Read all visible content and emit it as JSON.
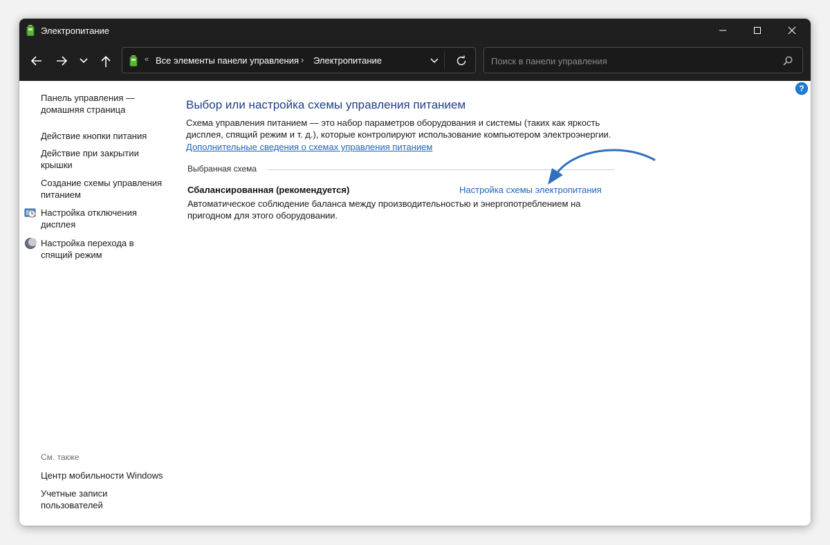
{
  "window": {
    "title": "Электропитание"
  },
  "address_bar": {
    "overflow_glyph": "«",
    "breadcrumbs": [
      "Все элементы панели управления",
      "Электропитание"
    ],
    "separator": "›"
  },
  "search": {
    "placeholder": "Поиск в панели управления",
    "value": ""
  },
  "help": {
    "label": "?"
  },
  "sidebar": {
    "items": [
      {
        "label": "Панель управления — домашняя страница"
      },
      {
        "label": "Действие кнопки питания"
      },
      {
        "label": "Действие при закрытии крышки"
      },
      {
        "label": "Создание схемы управления питанием"
      },
      {
        "label": "Настройка отключения дисплея",
        "icon": "display-clock-icon"
      },
      {
        "label": "Настройка перехода в спящий режим",
        "icon": "moon-icon"
      }
    ],
    "see_also_header": "См. также",
    "see_also": [
      {
        "label": "Центр мобильности Windows"
      },
      {
        "label": "Учетные записи пользователей"
      }
    ]
  },
  "main": {
    "title": "Выбор или настройка схемы управления питанием",
    "description": "Схема управления питанием — это набор параметров оборудования и системы (таких как яркость дисплея, спящий режим и т. д.), которые контролируют использование компьютером электроэнергии.",
    "more_link": "Дополнительные сведения о схемах управления питанием",
    "selected_group_label": "Выбранная схема",
    "plan": {
      "name": "Сбалансированная (рекомендуется)",
      "settings_link": "Настройка схемы электропитания",
      "description": "Автоматическое соблюдение баланса между производительностью и энергопотреблением на пригодном для этого оборудовании."
    }
  },
  "colors": {
    "titlebar": "#1f1f1f",
    "link": "#1e64b8",
    "heading": "#1e3f8a",
    "annotation_arrow": "#2f6fc0"
  }
}
